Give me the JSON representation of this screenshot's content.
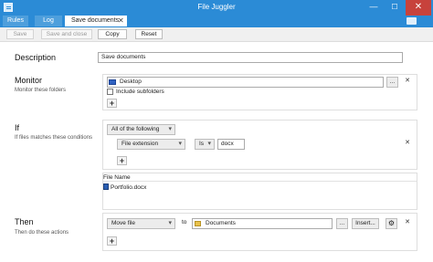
{
  "window": {
    "title": "File Juggler"
  },
  "tabs": [
    {
      "label": "Rules"
    },
    {
      "label": "Log"
    },
    {
      "label": "Save documents",
      "close": "✕"
    }
  ],
  "window_buttons": {
    "minimize": "—",
    "maximize": "☐",
    "close": "✕"
  },
  "toolbar": {
    "save": "Save",
    "save_close": "Save and close",
    "copy": "Copy",
    "reset": "Reset"
  },
  "description": {
    "heading": "Description",
    "value": "Save documents"
  },
  "monitor": {
    "heading": "Monitor",
    "sub": "Monitor these folders",
    "folder": "Desktop",
    "browse": "...",
    "include_subfolders": "Include subfolders",
    "add": "+"
  },
  "if": {
    "heading": "If",
    "sub": "If files matches these conditions",
    "match_mode": "All of the following",
    "condition": {
      "field": "File extension",
      "operator": "Is",
      "value": "docx"
    },
    "add": "+",
    "file_list_header": "File Name",
    "files": [
      "Portfolio.docx"
    ]
  },
  "then": {
    "heading": "Then",
    "sub": "Then do these actions",
    "action": "Move file",
    "to_label": "to",
    "destination": "Documents",
    "browse": "...",
    "insert": "Insert...",
    "add": "+"
  }
}
